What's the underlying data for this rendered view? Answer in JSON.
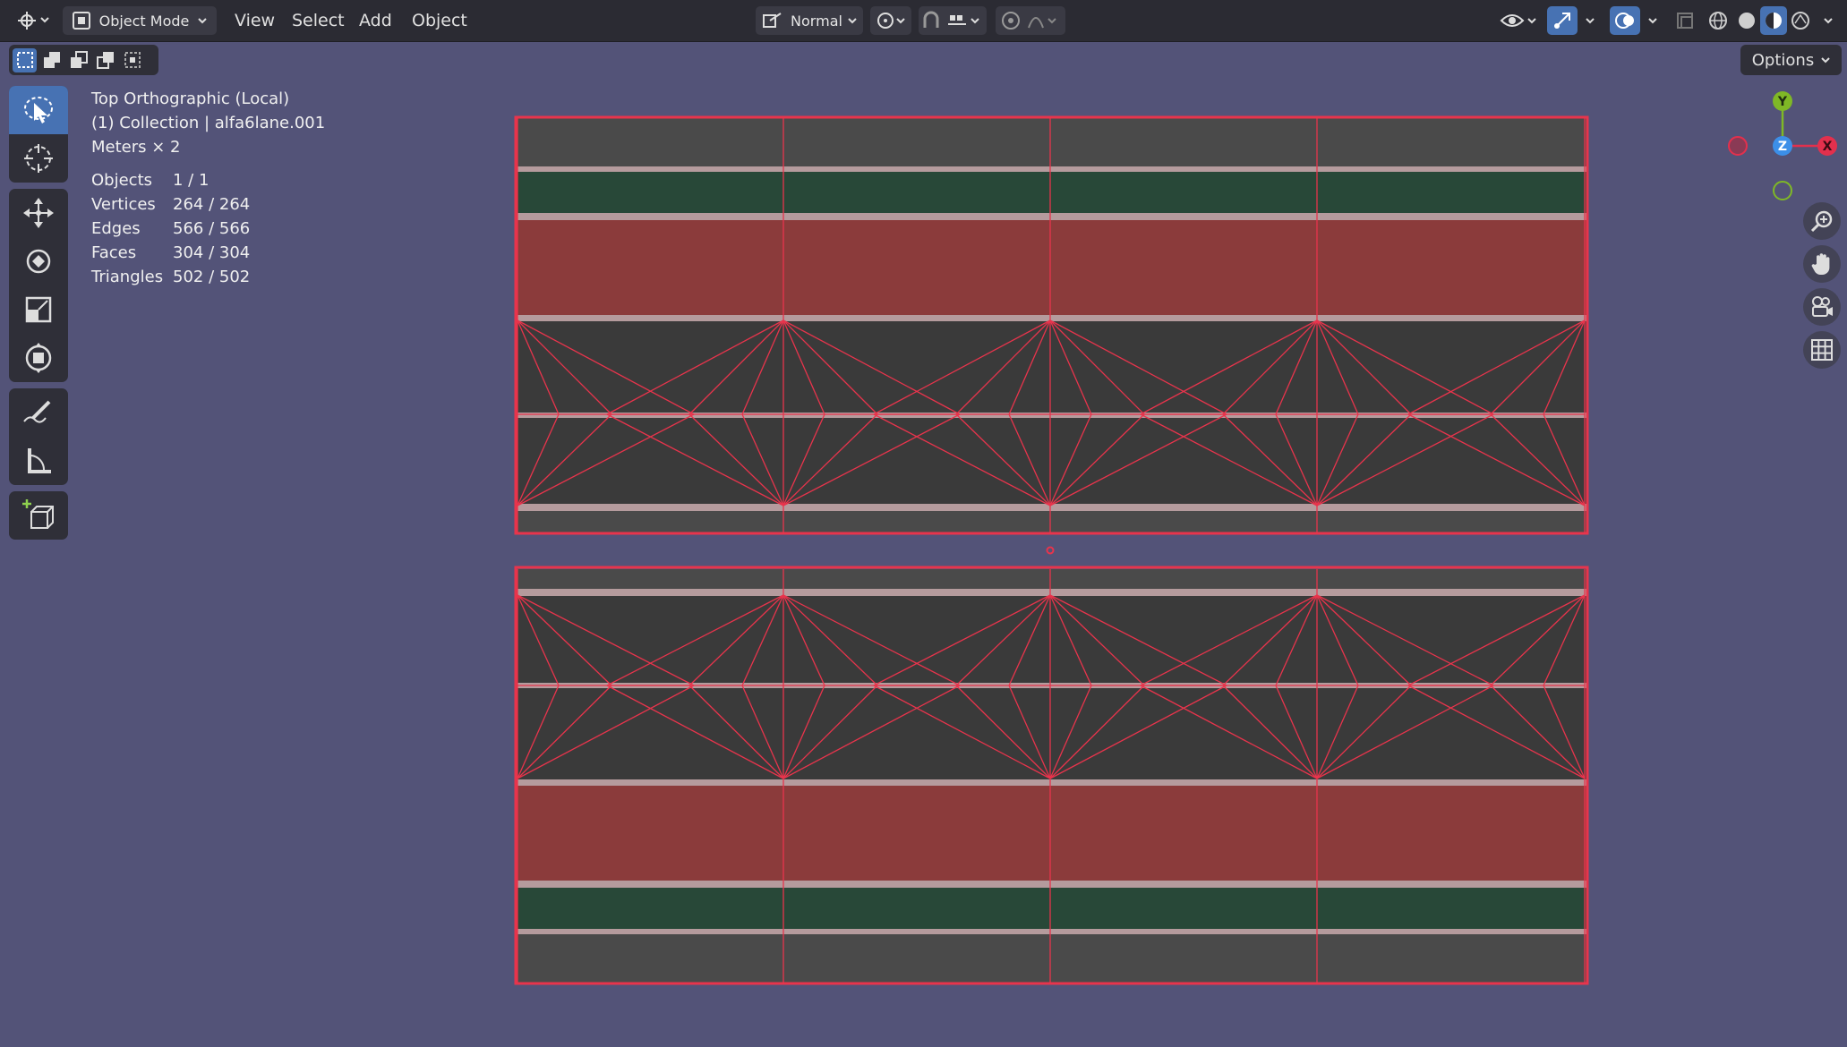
{
  "header": {
    "mode_label": "Object Mode",
    "menu": [
      "View",
      "Select",
      "Add",
      "Object"
    ],
    "orientation_label": "Normal",
    "options_label": "Options"
  },
  "overlay": {
    "view_name": "Top Orthographic (Local)",
    "collection": "(1) Collection | alfa6lane.001",
    "scale": "Meters × 2",
    "stats": [
      {
        "label": "Objects",
        "value": "1 / 1"
      },
      {
        "label": "Vertices",
        "value": "264 / 264"
      },
      {
        "label": "Edges",
        "value": "566 / 566"
      },
      {
        "label": "Faces",
        "value": "304 / 304"
      },
      {
        "label": "Triangles",
        "value": "502 / 502"
      }
    ]
  },
  "gizmo": {
    "y_label": "Y",
    "z_label": "Z",
    "x_label": "X",
    "colors": {
      "x": "#e3304d",
      "y": "#7fb826",
      "z": "#3c8fe8"
    }
  },
  "colors": {
    "accent": "#4772b3",
    "selection": "#e8344c",
    "road_red": "#8b3b3b",
    "road_green": "#284838",
    "asphalt": "#3a3a3a",
    "viewport_bg": "#535378"
  },
  "icons": {
    "editor_type": "editor-type-icon",
    "transform_orientation": "orientation-icon",
    "pivot": "pivot-icon",
    "snap": "snap-icon",
    "proportional": "proportional-edit-icon",
    "visibility": "visibility-icon",
    "gizmo_toggle": "gizmo-icon",
    "overlay_toggle": "overlay-icon",
    "xray": "xray-icon",
    "shading": [
      "wireframe-shading-icon",
      "solid-shading-icon",
      "material-shading-icon",
      "rendered-shading-icon"
    ],
    "tools": [
      "select-box-icon",
      "cursor-icon",
      "move-icon",
      "rotate-icon",
      "scale-icon",
      "transform-icon",
      "annotate-icon",
      "measure-icon",
      "add-cube-icon"
    ],
    "nav": [
      "zoom-icon",
      "pan-hand-icon",
      "camera-icon",
      "grid-icon"
    ]
  }
}
